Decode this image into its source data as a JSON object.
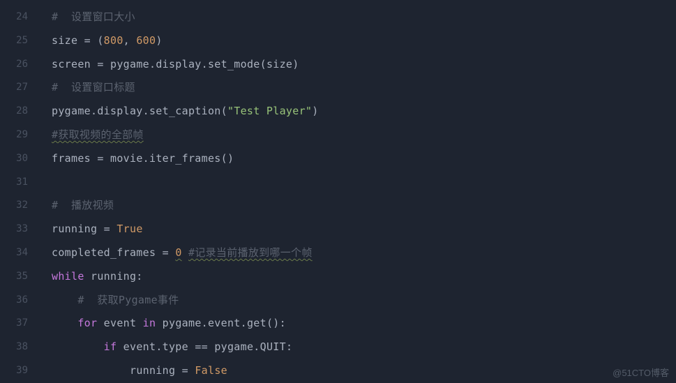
{
  "lineNumbers": [
    "24",
    "25",
    "26",
    "27",
    "28",
    "29",
    "30",
    "31",
    "32",
    "33",
    "34",
    "35",
    "36",
    "37",
    "38",
    "39"
  ],
  "code": {
    "l24": {
      "comment": "#  设置窗口大小"
    },
    "l25": {
      "t1": "size ",
      "op": "=",
      "t2": " (",
      "n1": "800",
      "comma": ", ",
      "n2": "600",
      "t3": ")"
    },
    "l26": {
      "t1": "screen ",
      "op": "=",
      "t2": " pygame.display.set_mode(size)"
    },
    "l27": {
      "comment": "#  设置窗口标题"
    },
    "l28": {
      "t1": "pygame.display.set_caption(",
      "str": "\"Test Player\"",
      "t2": ")"
    },
    "l29": {
      "comment": "#获取视频的全部帧"
    },
    "l30": {
      "t1": "frames ",
      "op": "=",
      "t2": " movie.iter_frames()"
    },
    "l31": {
      "blank": ""
    },
    "l32": {
      "comment": "#  播放视频"
    },
    "l33": {
      "t1": "running ",
      "op": "=",
      "sp": " ",
      "val": "True"
    },
    "l34": {
      "t1": "completed_frames ",
      "op": "=",
      "sp": " ",
      "num": "0",
      "sp2": " ",
      "comment": "#记录当前播放到哪一个帧"
    },
    "l35": {
      "kw": "while",
      "t1": " running:"
    },
    "l36": {
      "indent": "    ",
      "comment": "#  获取Pygame事件"
    },
    "l37": {
      "indent": "    ",
      "kw1": "for",
      "t1": " event ",
      "kw2": "in",
      "t2": " pygame.event.get():"
    },
    "l38": {
      "indent": "        ",
      "kw": "if",
      "t1": " event.type ",
      "op": "==",
      "t2": " pygame.QUIT:"
    },
    "l39": {
      "indent": "            ",
      "t1": "running ",
      "op": "=",
      "sp": " ",
      "val": "False"
    }
  },
  "watermark": "@51CTO博客"
}
